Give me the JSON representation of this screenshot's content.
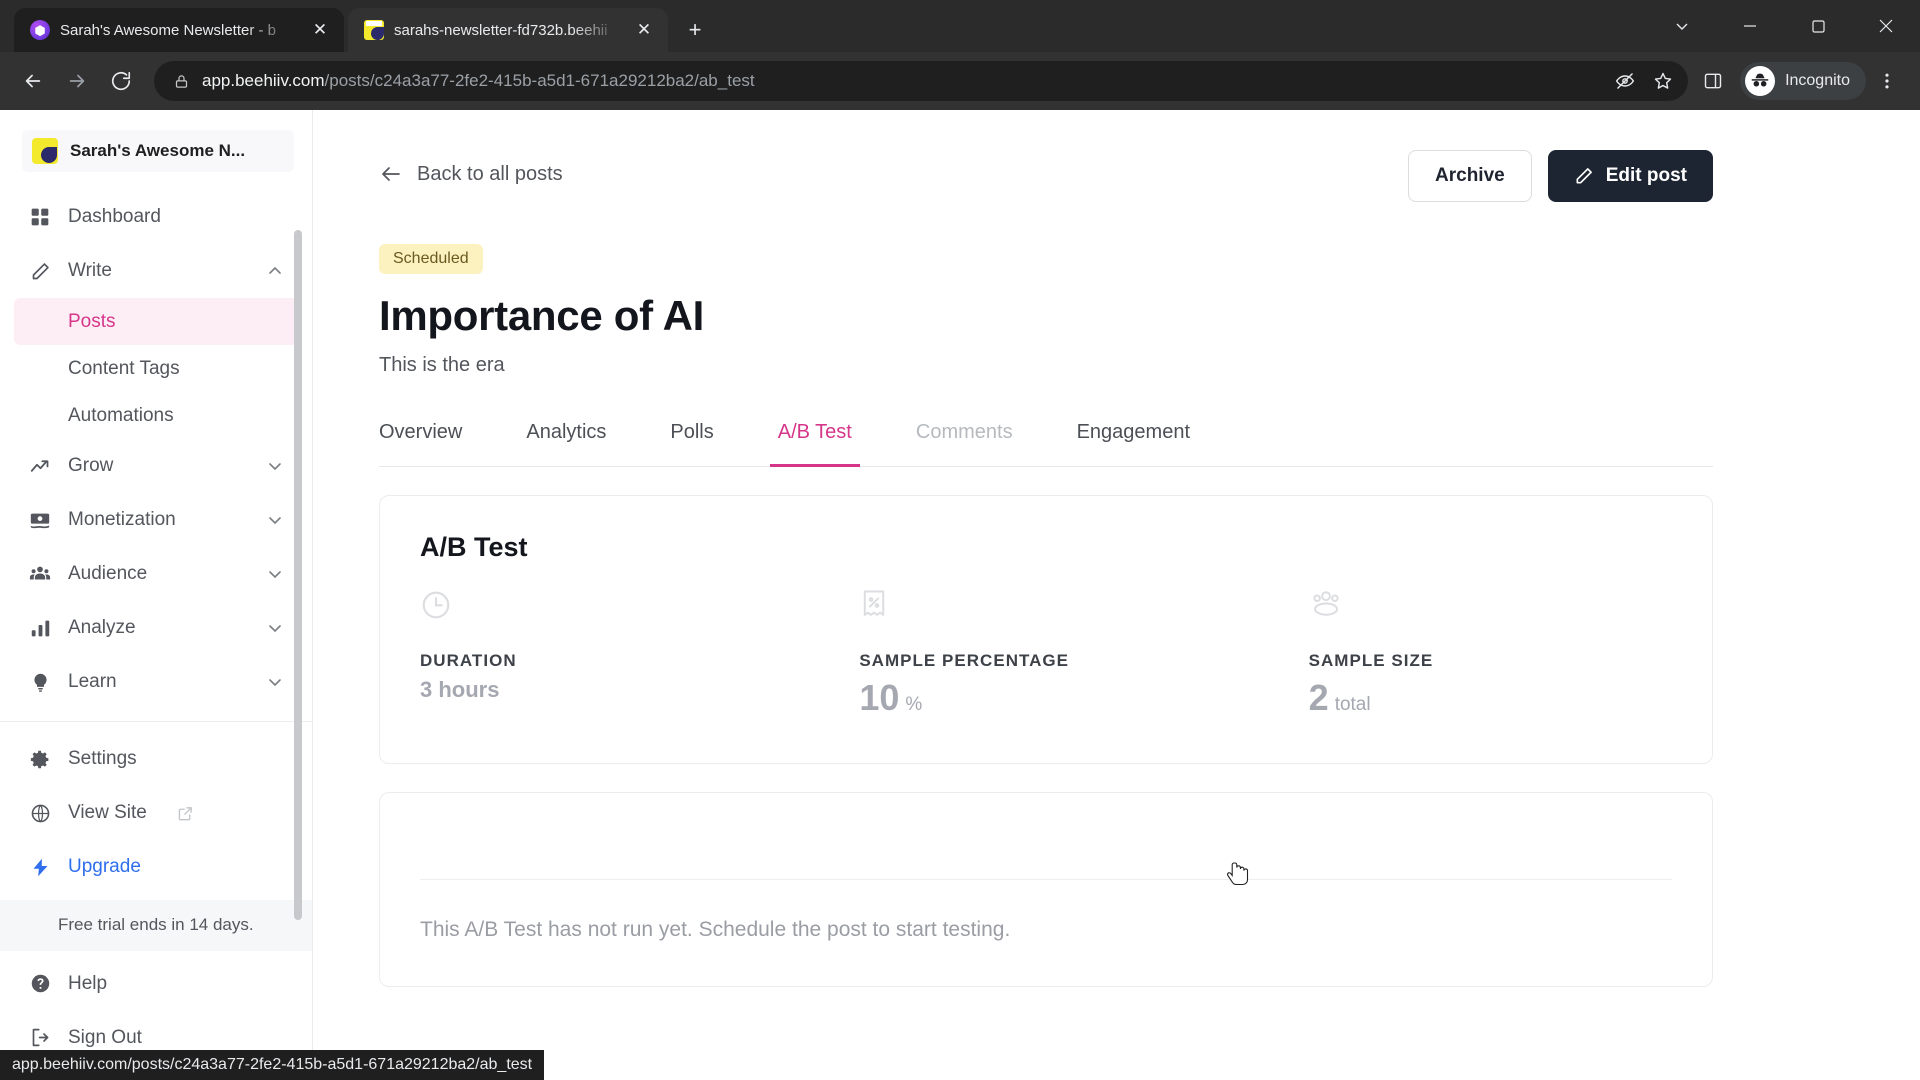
{
  "browser": {
    "tabs": [
      {
        "title": "Sarah's Awesome Newsletter - b",
        "favicon": "beehiiv-icon",
        "close_label": "✕",
        "active": true
      },
      {
        "title": "sarahs-newsletter-fd732b.beehii",
        "favicon": "newsletter-icon",
        "close_label": "✕",
        "active": false
      }
    ],
    "new_tab_label": "+",
    "window_controls": {
      "minimize": "—",
      "maximize": "▢",
      "close": "✕",
      "tab_search": "⌄"
    },
    "nav": {
      "back": "←",
      "forward": "→",
      "reload": "⟳"
    },
    "omnibox": {
      "url_host": "app.beehiiv.com",
      "url_path": "/posts/c24a3a77-2fe2-415b-a5d1-671a29212ba2/ab_test",
      "lock_icon": "lock-icon"
    },
    "toolbar_icons": [
      "third-party-cookie-blocked-icon",
      "bookmark-star-icon",
      "side-panel-icon",
      "kebab-menu-icon"
    ],
    "profile": {
      "label": "Incognito",
      "icon": "incognito-icon"
    },
    "status_bar_url": "app.beehiiv.com/posts/c24a3a77-2fe2-415b-a5d1-671a29212ba2/ab_test"
  },
  "sidebar": {
    "brand": {
      "name": "Sarah's Awesome N...",
      "logo": "newsletter-logo"
    },
    "items": [
      {
        "label": "Dashboard",
        "icon": "grid-icon",
        "expandable": false
      },
      {
        "label": "Write",
        "icon": "pencil-icon",
        "expandable": true,
        "expanded": true,
        "chevron": "⌃"
      },
      {
        "label": "Grow",
        "icon": "trending-up-icon",
        "expandable": true,
        "expanded": false,
        "chevron": "⌄"
      },
      {
        "label": "Monetization",
        "icon": "money-icon",
        "expandable": true,
        "expanded": false,
        "chevron": "⌄"
      },
      {
        "label": "Audience",
        "icon": "people-icon",
        "expandable": true,
        "expanded": false,
        "chevron": "⌄"
      },
      {
        "label": "Analyze",
        "icon": "bar-chart-icon",
        "expandable": true,
        "expanded": false,
        "chevron": "⌄"
      },
      {
        "label": "Learn",
        "icon": "lightbulb-icon",
        "expandable": true,
        "expanded": false,
        "chevron": "⌄"
      }
    ],
    "write_subitems": [
      {
        "label": "Posts",
        "active": true
      },
      {
        "label": "Content Tags",
        "active": false
      },
      {
        "label": "Automations",
        "active": false
      }
    ],
    "bottom_items": [
      {
        "label": "Settings",
        "icon": "gear-icon"
      },
      {
        "label": "View Site",
        "icon": "globe-icon",
        "external": "external-link-icon"
      },
      {
        "label": "Upgrade",
        "icon": "bolt-icon",
        "accent": true
      }
    ],
    "trial_notice": "Free trial ends in 14 days.",
    "footer_items": [
      {
        "label": "Help",
        "icon": "question-circle-icon"
      },
      {
        "label": "Sign Out",
        "icon": "logout-icon"
      }
    ]
  },
  "main": {
    "back_link": "Back to all posts",
    "back_icon": "arrow-left-icon",
    "actions": {
      "archive_label": "Archive",
      "edit_label": "Edit post",
      "edit_icon": "pencil-icon"
    },
    "status_badge": "Scheduled",
    "post_title": "Importance of AI",
    "post_subtitle": "This is the era",
    "tabs": [
      {
        "label": "Overview",
        "state": "normal"
      },
      {
        "label": "Analytics",
        "state": "normal"
      },
      {
        "label": "Polls",
        "state": "normal"
      },
      {
        "label": "A/B Test",
        "state": "active"
      },
      {
        "label": "Comments",
        "state": "muted"
      },
      {
        "label": "Engagement",
        "state": "normal"
      }
    ],
    "ab_card": {
      "title": "A/B Test",
      "stats": [
        {
          "icon": "clock-icon",
          "label": "DURATION",
          "value": "3 hours",
          "unit": ""
        },
        {
          "icon": "percent-receipt-icon",
          "label": "SAMPLE PERCENTAGE",
          "value": "10",
          "unit": "%"
        },
        {
          "icon": "people-group-icon",
          "label": "SAMPLE SIZE",
          "value": "2",
          "unit": "total"
        }
      ]
    },
    "empty_state": {
      "message": "This A/B Test has not run yet. Schedule the post to start testing."
    }
  },
  "colors": {
    "accent_pink": "#d6368a",
    "badge_bg": "#fbf2c0",
    "dark_button": "#1e2532",
    "upgrade_blue": "#2f6fed"
  }
}
